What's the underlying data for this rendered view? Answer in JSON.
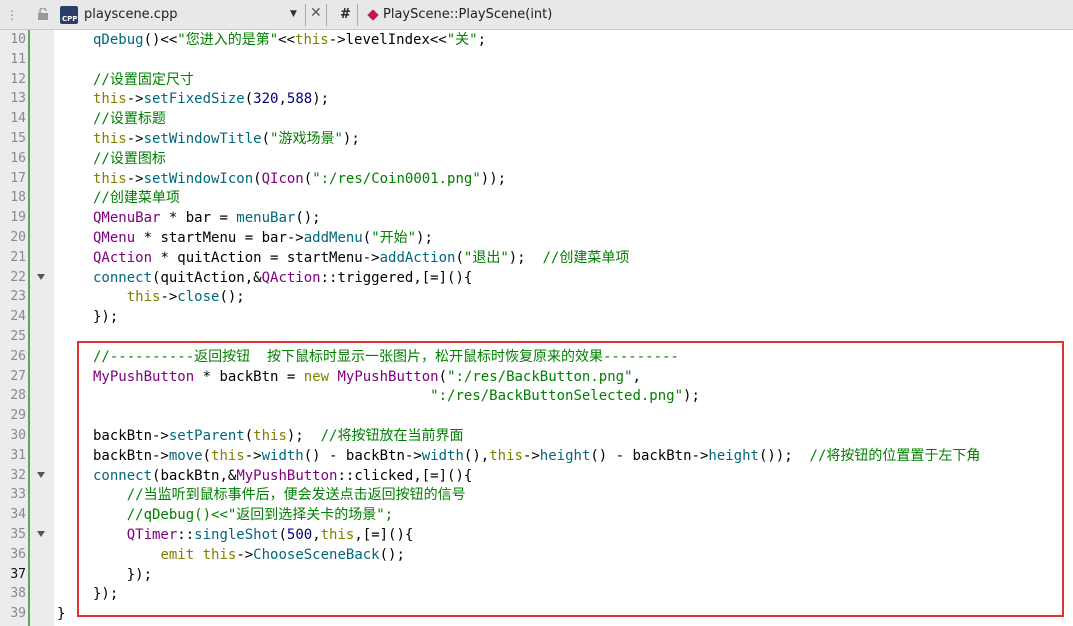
{
  "toolbar": {
    "file_name": "playscene.cpp",
    "file_icon_label": "CPP",
    "symbol_hash": "#",
    "current_symbol": "PlayScene::PlayScene(int)"
  },
  "editor": {
    "current_line": 37,
    "fold_lines": [
      22,
      32,
      35
    ],
    "highlight_range": [
      26,
      39
    ],
    "lines": [
      {
        "n": "10",
        "code": "qDebug()<<\"您进入的是第\"<<this->levelIndex<<\"关\";"
      },
      {
        "n": "11",
        "code": ""
      },
      {
        "n": "12",
        "code": "//设置固定尺寸"
      },
      {
        "n": "13",
        "code": "this->setFixedSize(320,588);"
      },
      {
        "n": "14",
        "code": "//设置标题"
      },
      {
        "n": "15",
        "code": "this->setWindowTitle(\"游戏场景\");"
      },
      {
        "n": "16",
        "code": "//设置图标"
      },
      {
        "n": "17",
        "code": "this->setWindowIcon(QIcon(\":/res/Coin0001.png\"));"
      },
      {
        "n": "18",
        "code": "//创建菜单项"
      },
      {
        "n": "19",
        "code": "QMenuBar * bar = menuBar();"
      },
      {
        "n": "20",
        "code": "QMenu * startMenu = bar->addMenu(\"开始\");"
      },
      {
        "n": "21",
        "code": "QAction * quitAction = startMenu->addAction(\"退出\");  //创建菜单项"
      },
      {
        "n": "22",
        "code": "connect(quitAction,&QAction::triggered,[=](){"
      },
      {
        "n": "23",
        "code": "    this->close();"
      },
      {
        "n": "24",
        "code": "});"
      },
      {
        "n": "25",
        "code": ""
      },
      {
        "n": "26",
        "code": "//----------返回按钮  按下鼠标时显示一张图片，松开鼠标时恢复原来的效果---------"
      },
      {
        "n": "27",
        "code": "MyPushButton * backBtn = new MyPushButton(\":/res/BackButton.png\","
      },
      {
        "n": "28",
        "code": "                                        \":/res/BackButtonSelected.png\");"
      },
      {
        "n": "29",
        "code": ""
      },
      {
        "n": "30",
        "code": "backBtn->setParent(this);  //将按钮放在当前界面"
      },
      {
        "n": "31",
        "code": "backBtn->move(this->width() - backBtn->width(),this->height() - backBtn->height());  //将按钮的位置置于左下角"
      },
      {
        "n": "32",
        "code": "connect(backBtn,&MyPushButton::clicked,[=](){"
      },
      {
        "n": "33",
        "code": "    //当监听到鼠标事件后，便会发送点击返回按钮的信号"
      },
      {
        "n": "34",
        "code": "    //qDebug()<<\"返回到选择关卡的场景\";"
      },
      {
        "n": "35",
        "code": "    QTimer::singleShot(500,this,[=](){"
      },
      {
        "n": "36",
        "code": "        emit this->ChooseSceneBack();"
      },
      {
        "n": "37",
        "code": "    });"
      },
      {
        "n": "38",
        "code": "});"
      },
      {
        "n": "39",
        "code": "}"
      }
    ]
  }
}
